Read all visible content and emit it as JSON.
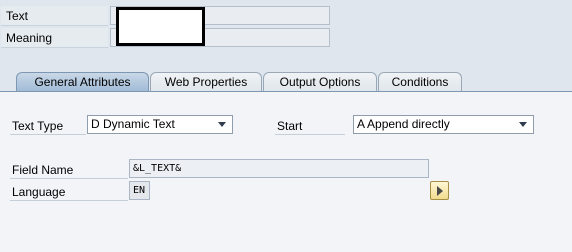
{
  "header": {
    "text_label": "Text",
    "meaning_label": "Meaning",
    "text_value": "",
    "meaning_value": ""
  },
  "tabs": [
    {
      "label": "General Attributes",
      "active": true
    },
    {
      "label": "Web Properties",
      "active": false
    },
    {
      "label": "Output Options",
      "active": false
    },
    {
      "label": "Conditions",
      "active": false
    }
  ],
  "general": {
    "text_type_label": "Text Type",
    "text_type_value": "D Dynamic Text",
    "start_label": "Start",
    "start_value": "A Append directly",
    "field_name_label": "Field Name",
    "field_name_value": "&L_TEXT&",
    "language_label": "Language",
    "language_value": "EN"
  },
  "icons": {
    "navigate": "triangle-right-icon",
    "dropdown": "chevron-down-icon"
  },
  "colors": {
    "active_tab": "#9fbad6",
    "background": "#dfe6ed",
    "nav_button": "#f1dc8d"
  }
}
